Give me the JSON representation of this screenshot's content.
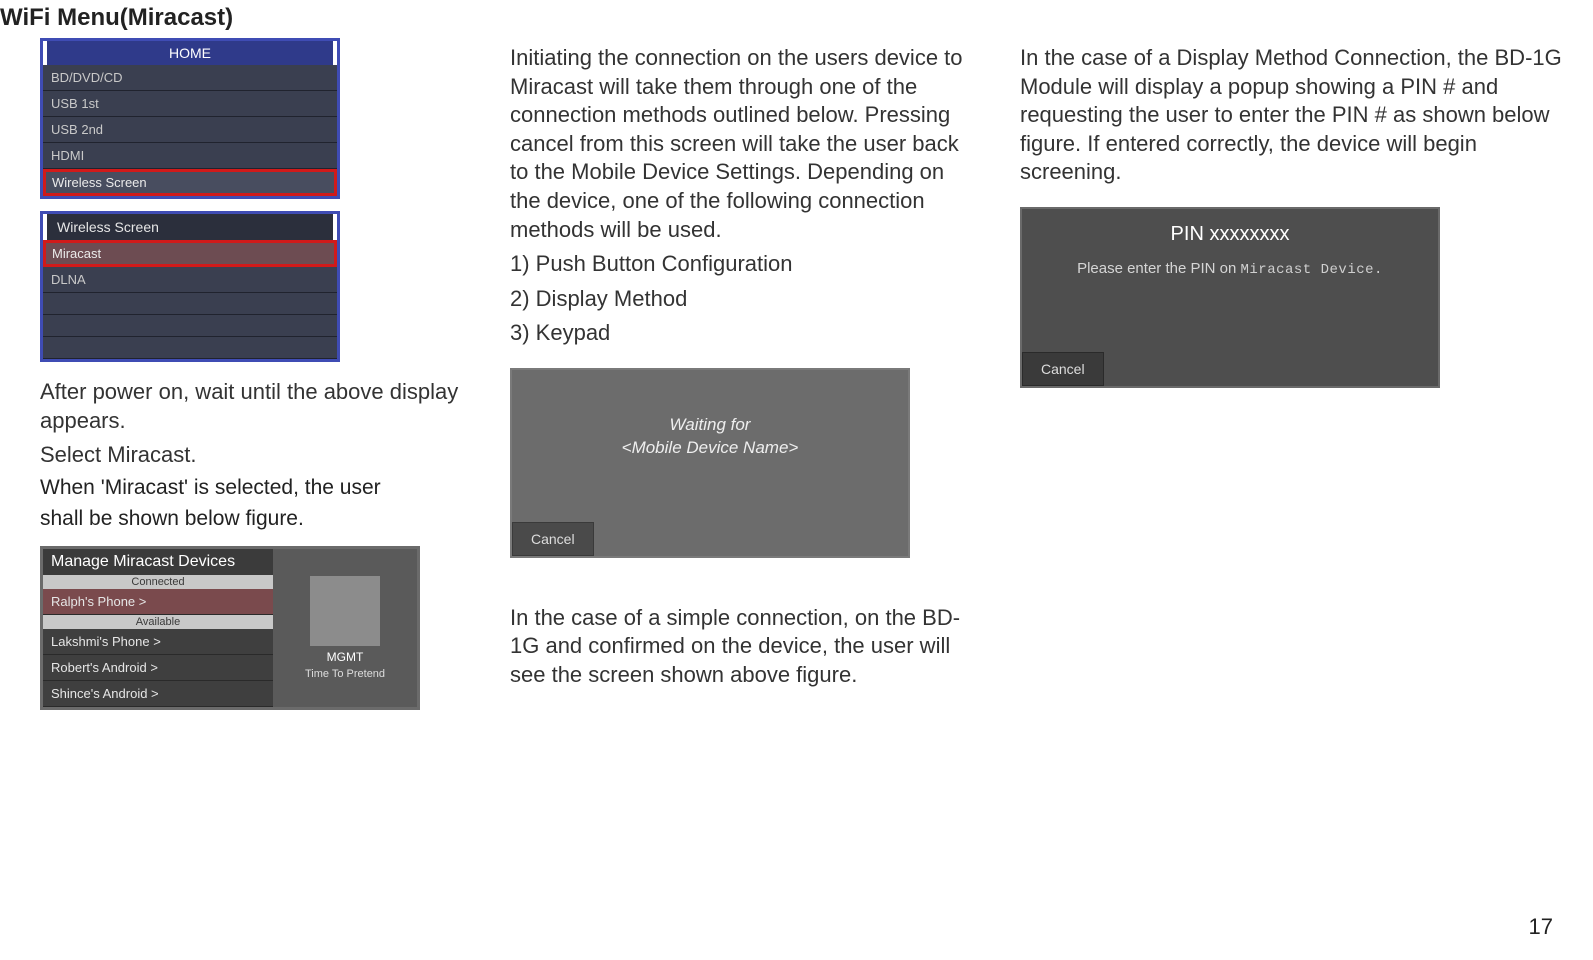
{
  "page": {
    "title": "WiFi Menu(Miracast)",
    "number": "17"
  },
  "home_menu": {
    "header": "HOME",
    "items": [
      "BD/DVD/CD",
      "USB 1st",
      "USB 2nd",
      "HDMI",
      "Wireless Screen"
    ],
    "highlight_index": 4
  },
  "wireless_menu": {
    "header": "Wireless Screen",
    "items": [
      "Miracast",
      "DLNA",
      "",
      "",
      ""
    ],
    "highlight_index": 0
  },
  "left_text": {
    "line1": "After power on, wait until the above display appears.",
    "line2": "Select Miracast.",
    "line3": "When 'Miracast' is selected, the user",
    "line4": "shall be shown below figure."
  },
  "manage": {
    "title": "Manage Miracast Devices",
    "connected_label": "Connected",
    "available_label": "Available",
    "connected": [
      "Ralph's Phone >"
    ],
    "available": [
      "Lakshmi's Phone >",
      "Robert's Android >",
      "Shince's Android >"
    ],
    "now_playing_artist": "MGMT",
    "now_playing_track": "Time To Pretend"
  },
  "mid_text": {
    "para": "Initiating the connection on the users device to Miracast will take them through one of the connection methods outlined below. Pressing cancel from this screen will take the user back to the Mobile Device Settings. Depending on the device, one of the following connection methods will be used.",
    "m1": "1) Push Button Configuration",
    "m2": "2) Display Method",
    "m3": "3) Keypad",
    "below": "In the case of a simple connection, on the BD-1G and confirmed on the device, the user will see the screen shown above figure."
  },
  "waiting_popup": {
    "line1": "Waiting for",
    "line2": "<Mobile Device Name>",
    "cancel": "Cancel"
  },
  "right_text": {
    "para": "In the case of a Display Method Connection, the BD-1G Module will display a popup showing a PIN # and requesting the user to enter the PIN # as shown below figure. If entered correctly, the device will begin screening."
  },
  "pin_popup": {
    "title": "PIN xxxxxxxx",
    "body_prefix": "Please enter the PIN on ",
    "body_device": "Miracast Device.",
    "cancel": "Cancel"
  }
}
